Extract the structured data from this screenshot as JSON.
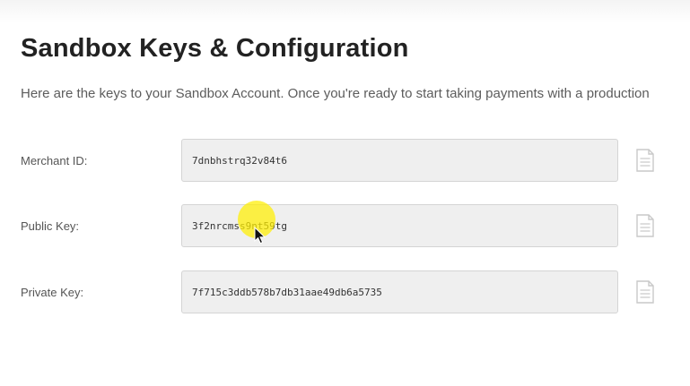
{
  "page": {
    "title": "Sandbox Keys & Configuration",
    "intro": "Here are the keys to your Sandbox Account. Once you're ready to start taking payments with a production"
  },
  "keys": [
    {
      "label": "Merchant ID:",
      "value": "7dnbhstrq32v84t6",
      "copy_icon": "clipboard-copy-icon"
    },
    {
      "label": "Public Key:",
      "value": "3f2nrcmss9nt59tg",
      "copy_icon": "clipboard-copy-icon"
    },
    {
      "label": "Private Key:",
      "value": "7f715c3ddb578b7db31aae49db6a5735",
      "copy_icon": "clipboard-copy-icon"
    }
  ],
  "colors": {
    "field_background": "#efefef",
    "field_border": "#d4d4d4",
    "cursor_highlight": "#ffee00"
  }
}
